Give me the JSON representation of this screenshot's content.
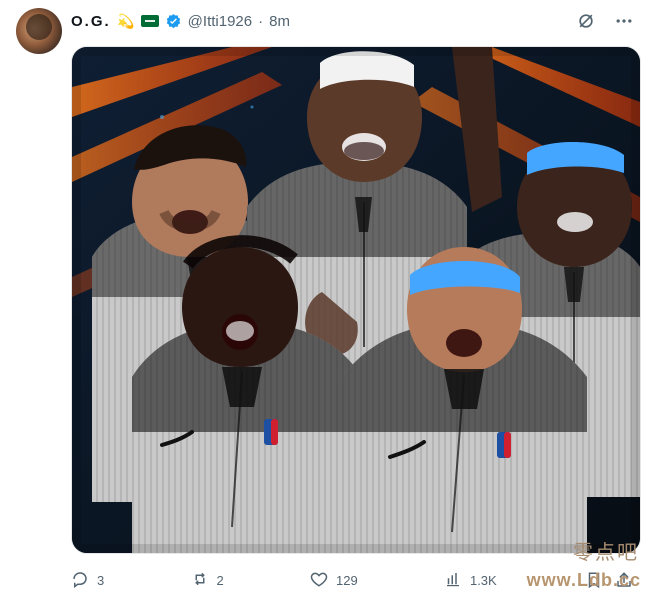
{
  "tweet": {
    "author": {
      "display_name": "O.G.",
      "handle": "@Itti1926",
      "time_ago": "8m",
      "sep": "·",
      "badges": [
        "sparkle-emoji",
        "saudi-flag",
        "verified-badge"
      ]
    },
    "top_actions": [
      "grok-icon",
      "more-icon"
    ],
    "media": {
      "subject": "basketball-referees"
    },
    "stats": {
      "replies": "3",
      "reposts": "2",
      "likes": "129",
      "views": "1.3K"
    }
  },
  "watermark": {
    "top": "零点吧",
    "bottom": "www.Ldb.cc"
  },
  "colors": {
    "text": "#0f1419",
    "muted": "#536471",
    "accent_blue": "#1d9bf0"
  }
}
